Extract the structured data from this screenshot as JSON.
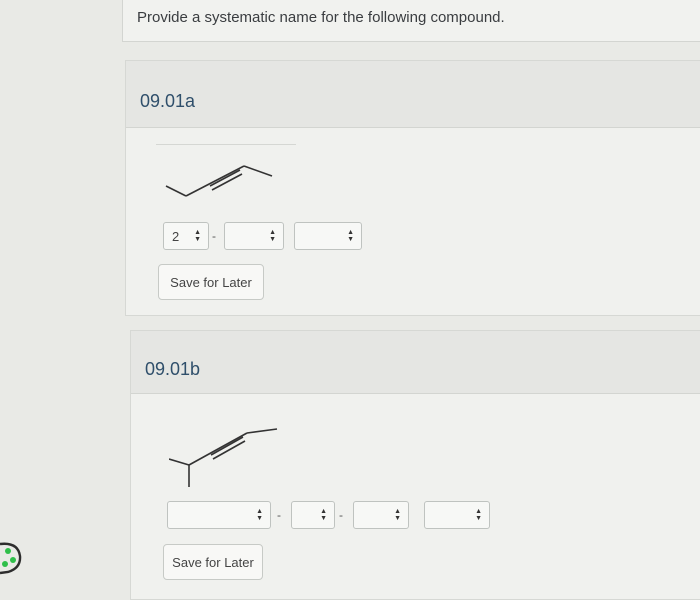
{
  "prompt": {
    "text": "Provide a systematic name for the following compound."
  },
  "question_a": {
    "title": "09.01a",
    "selects": [
      {
        "value": "2"
      },
      {
        "value": ""
      },
      {
        "value": ""
      }
    ],
    "separators": [
      "-"
    ],
    "save_label": "Save for Later"
  },
  "question_b": {
    "title": "09.01b",
    "selects": [
      {
        "value": ""
      },
      {
        "value": ""
      },
      {
        "value": ""
      },
      {
        "value": ""
      }
    ],
    "separators": [
      "-",
      "-"
    ],
    "save_label": "Save for Later"
  },
  "icons": {
    "stepper": "up-down-arrows-icon",
    "sidebar": "palette-icon"
  },
  "colors": {
    "title": "#2f4f6b",
    "background": "#e9eae6",
    "card": "#f0f1ee",
    "sidebar_icon": "#2fbf4a"
  }
}
